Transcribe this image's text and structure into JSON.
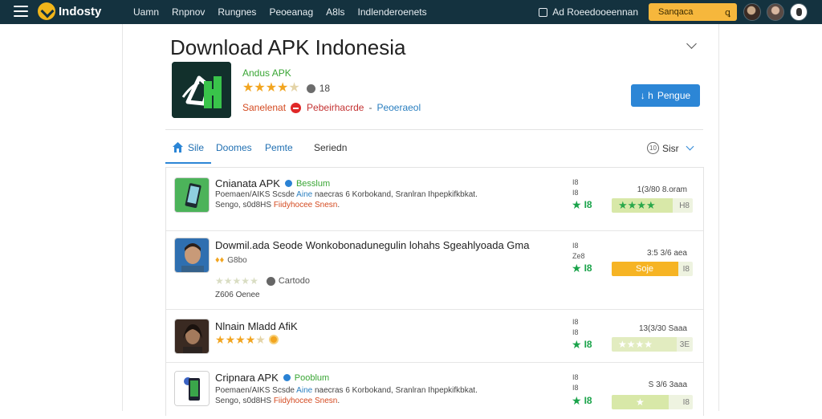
{
  "topbar": {
    "brand": "Indosty",
    "nav": [
      "Uamn",
      "Rnpnov",
      "Rungnes",
      "Peoeanag",
      "A8ls",
      "Indlenderoenets"
    ],
    "notification": "Ad Roeedooeennan",
    "search_label": "Sanqaca",
    "search_icon": "magnifier-icon",
    "colors": {
      "bar": "#14323f",
      "search": "#f6b73c"
    }
  },
  "header": {
    "title": "Download APK Indonesia",
    "app_name": "Andus APK",
    "rating_stars": 4,
    "rating_count": "18",
    "meta_a": "Sanelenat",
    "meta_b": "Pebeirhacrde",
    "meta_sep": "-",
    "meta_c": "Peoeraeol",
    "download_label": "Pengue",
    "download_arrow": "↓ h",
    "accent": "#2c86d6"
  },
  "tabs": {
    "items": [
      "Sile",
      "Doomes",
      "Pemte",
      "Seriedn"
    ],
    "active": 0,
    "sort_label": "Sisr",
    "sort_icon_text": "10"
  },
  "rows": [
    {
      "title": "Cnianata APK",
      "tag": "Besslum",
      "desc1_a": "Poemaen/AIKS Scsde ",
      "desc1_hl": "Aine",
      "desc1_b": " naecras 6 Korbokand, Sranlran Ihpepkifkbkat.",
      "desc2_a": "Sengo, s0d8HS ",
      "desc2_hl": "Fiidyhocee Snesn",
      "desc2_b": ".",
      "stat_top": "I8",
      "stat_mid": "I8",
      "green_num": "I8",
      "size": "1(3/80 8.oram",
      "bar_label": "H8",
      "bar_fill_pct": 75,
      "bar_fill_color": "#d8e8a8",
      "bar_star_count": 4
    },
    {
      "title": "Dowmil.ada Seode  Wonkobonadunegulin lohahs Sgeahlyoada Gma",
      "badges": "G8bo",
      "sub_label": "Cartodo",
      "sub_stars": 5,
      "desc_footer": "Z606 Oenee",
      "stat_top": "I8",
      "stat_mid": "Ze8",
      "green_num": "I8",
      "size": "3:5 3/6 aea",
      "bar_label": "I8",
      "bar_text": "Soje",
      "bar_fill_pct": 82,
      "bar_fill_color": "#f6b424"
    },
    {
      "title": "Nlnain Mladd AfiK",
      "stars": 4,
      "stat_top": "I8",
      "stat_mid": "I8",
      "green_num": "I8",
      "size": "13(3/30 Saaa",
      "bar_label": "3E",
      "bar_fill_pct": 80,
      "bar_fill_color": "#e2ecc0",
      "bar_star_count": 4
    },
    {
      "title": "Cripnara APK",
      "tag": "Pooblum",
      "desc1_a": "Poemaen/AIKS Scsde ",
      "desc1_hl": "Aine",
      "desc1_b": " naecras 6 Korbokand, Sranlran Ihpepkifkbkat.",
      "desc2_a": "Sengo, s0d8HS ",
      "desc2_hl": "Fiidyhocee Snesn",
      "desc2_b": ".",
      "stat_top": "I8",
      "stat_mid": "I8",
      "green_num": "I8",
      "size": "S 3/6 3aaa",
      "bar_label": "I8",
      "bar_fill_pct": 70,
      "bar_fill_color": "#d8e8a8",
      "bar_star_count": 1
    }
  ]
}
